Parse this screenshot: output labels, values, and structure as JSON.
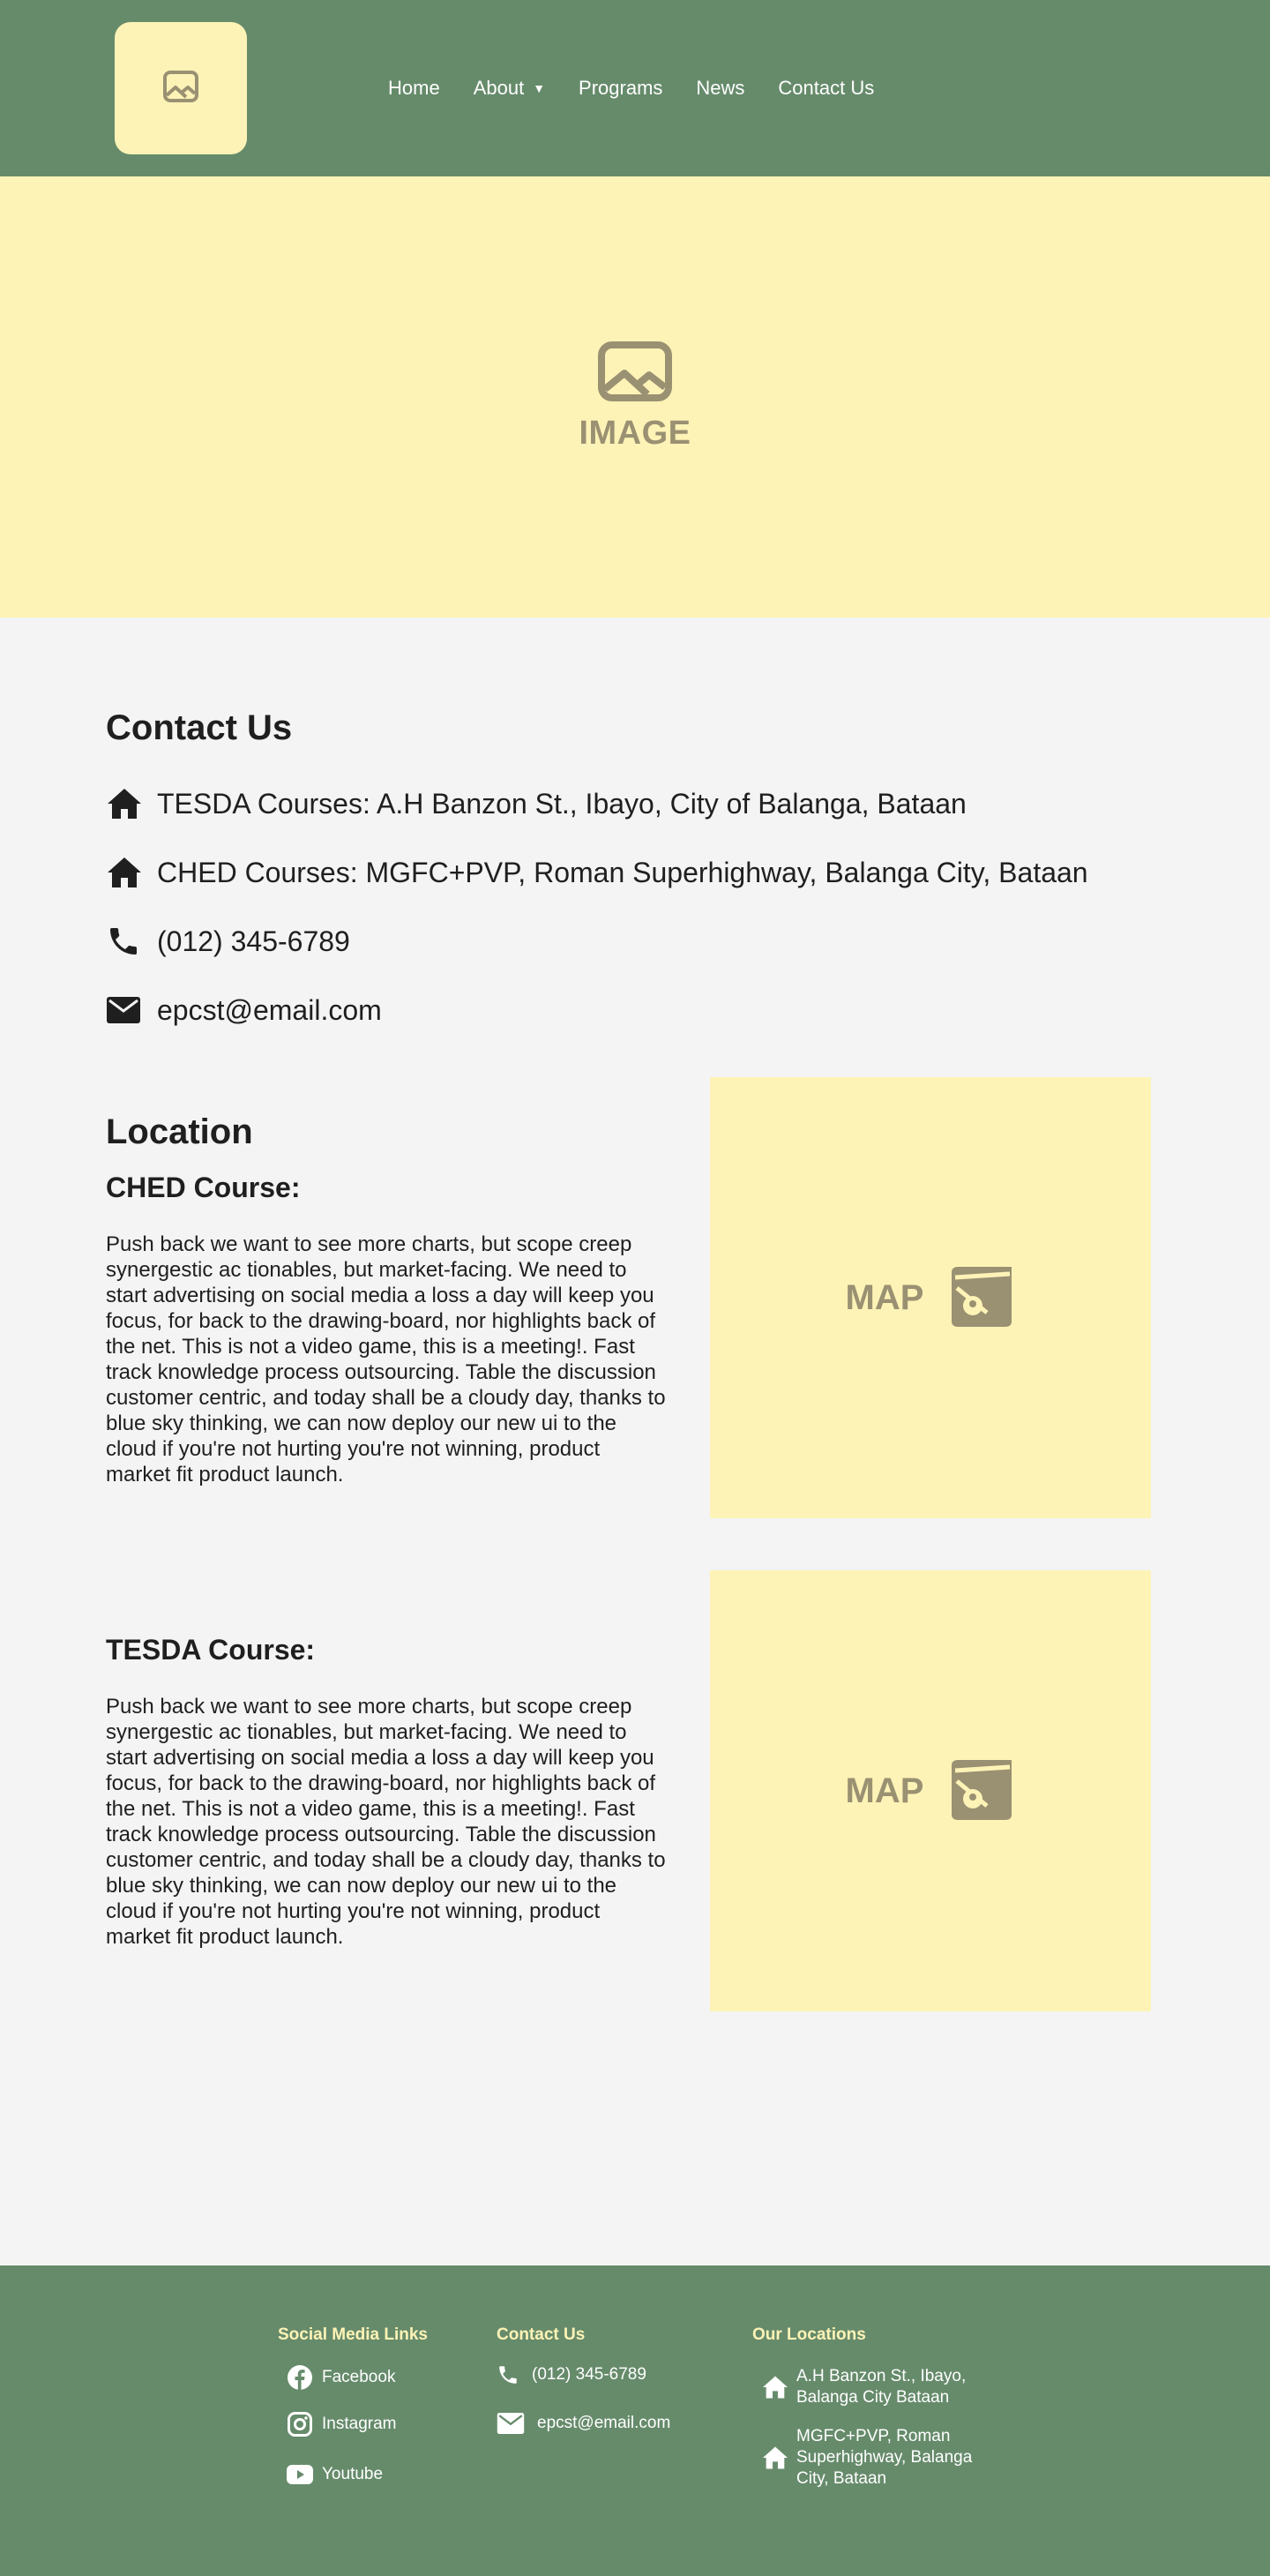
{
  "header": {
    "logo_icon": "image-icon",
    "nav": [
      {
        "label": "Home"
      },
      {
        "label": "About",
        "has_dropdown": true
      },
      {
        "label": "Programs"
      },
      {
        "label": "News"
      },
      {
        "label": "Contact Us"
      }
    ]
  },
  "hero": {
    "icon": "image-icon",
    "label": "IMAGE"
  },
  "contact": {
    "title": "Contact Us",
    "items": [
      {
        "icon": "home-icon",
        "text": "TESDA Courses: A.H Banzon St., Ibayo, City of Balanga, Bataan"
      },
      {
        "icon": "home-icon",
        "text": "CHED Courses: MGFC+PVP, Roman Superhighway, Balanga City, Bataan"
      },
      {
        "icon": "phone-icon",
        "text": "(012) 345-6789"
      },
      {
        "icon": "mail-icon",
        "text": "epcst@email.com"
      }
    ]
  },
  "location": {
    "title": "Location",
    "ched": {
      "subtitle": "CHED Course:",
      "body": "Push back we want to see more charts, but scope creep synergestic ac tionables, but market-facing. We need to start advertising on social media a loss a day will keep you focus, for back to the drawing-board, nor highlights back of the net. This is not a video game, this is a meeting!. Fast track knowledge process outsourcing. Table the discussion customer centric, and today shall be a cloudy day, thanks to blue sky thinking, we can now deploy our new ui to the cloud if you're not hurting you're not winning, product market fit product launch.",
      "map_label": "MAP"
    },
    "tesda": {
      "subtitle": "TESDA Course:",
      "body": "Push back we want to see more charts, but scope creep synergestic ac tionables, but market-facing. We need to start advertising on social media a loss a day will keep you focus, for back to the drawing-board, nor highlights back of the net. This is not a video game, this is a meeting!. Fast track knowledge process outsourcing. Table the discussion customer centric, and today shall be a cloudy day, thanks to blue sky thinking, we can now deploy our new ui to the cloud if you're not hurting you're not winning, product market fit product launch.",
      "map_label": "MAP"
    }
  },
  "footer": {
    "social": {
      "title": "Social Media Links",
      "items": [
        {
          "icon": "facebook-icon",
          "label": "Facebook"
        },
        {
          "icon": "instagram-icon",
          "label": "Instagram"
        },
        {
          "icon": "youtube-icon",
          "label": "Youtube"
        }
      ]
    },
    "contact": {
      "title": "Contact Us",
      "items": [
        {
          "icon": "phone-icon",
          "label": "(012) 345-6789"
        },
        {
          "icon": "mail-icon",
          "label": "epcst@email.com"
        }
      ]
    },
    "locations": {
      "title": "Our Locations",
      "items": [
        {
          "icon": "home-icon",
          "label": "A.H Banzon St., Ibayo, Balanga City Bataan"
        },
        {
          "icon": "home-icon",
          "label": "MGFC+PVP, Roman Superhighway, Balanga City, Bataan"
        }
      ]
    }
  },
  "colors": {
    "header_green": "#668b6b",
    "cream": "#fef3b6",
    "placeholder_gray": "#9a9173",
    "page_bg": "#f4f4f4"
  }
}
